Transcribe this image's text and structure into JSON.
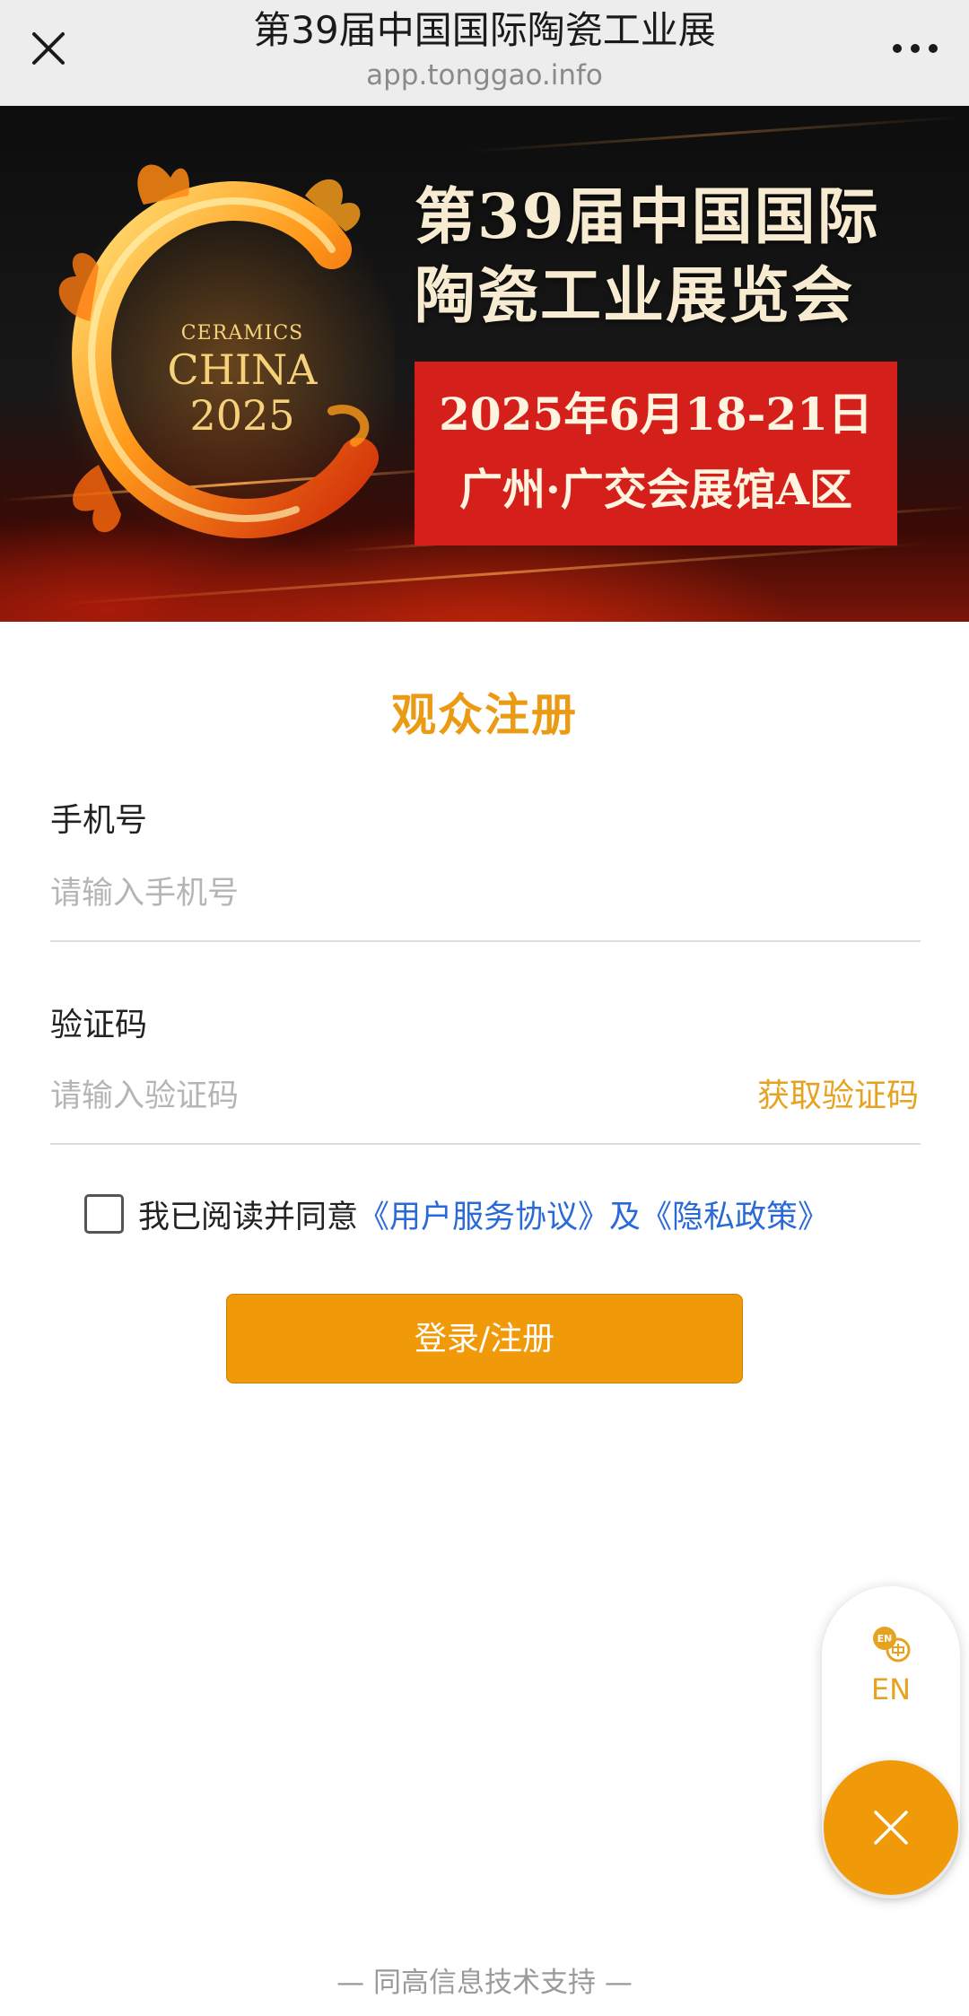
{
  "nav": {
    "title": "第39届中国国际陶瓷工业展",
    "url": "app.tonggao.info",
    "close_icon": "close-icon",
    "more_icon": "more-dots-icon"
  },
  "banner": {
    "logo": {
      "line1": "CERAMICS",
      "line2": "CHINA",
      "line3": "2025"
    },
    "headline_line1": "第39届中国国际",
    "headline_line2": "陶瓷工业展览会",
    "date": "2025年6月18-21日",
    "venue": "广州·广交会展馆A区"
  },
  "form": {
    "title": "观众注册",
    "phone": {
      "label": "手机号",
      "placeholder": "请输入手机号",
      "value": ""
    },
    "code": {
      "label": "验证码",
      "placeholder": "请输入验证码",
      "value": "",
      "get_code_label": "获取验证码"
    },
    "agreement": {
      "checked": false,
      "prefix": "我已阅读并同意",
      "terms_link": "《用户服务协议》",
      "conjunction": "及",
      "privacy_link": "《隐私政策》"
    },
    "submit_label": "登录/注册"
  },
  "floating": {
    "lang_label": "EN",
    "lang_icon": "language-switch-icon",
    "close_icon": "close-icon"
  },
  "footer": {
    "text": "— 同高信息技术支持 —"
  },
  "colors": {
    "accent": "#f09a0a",
    "title": "#eb9a14",
    "link": "#2a6ad8",
    "banner_red": "#d51f1a"
  }
}
